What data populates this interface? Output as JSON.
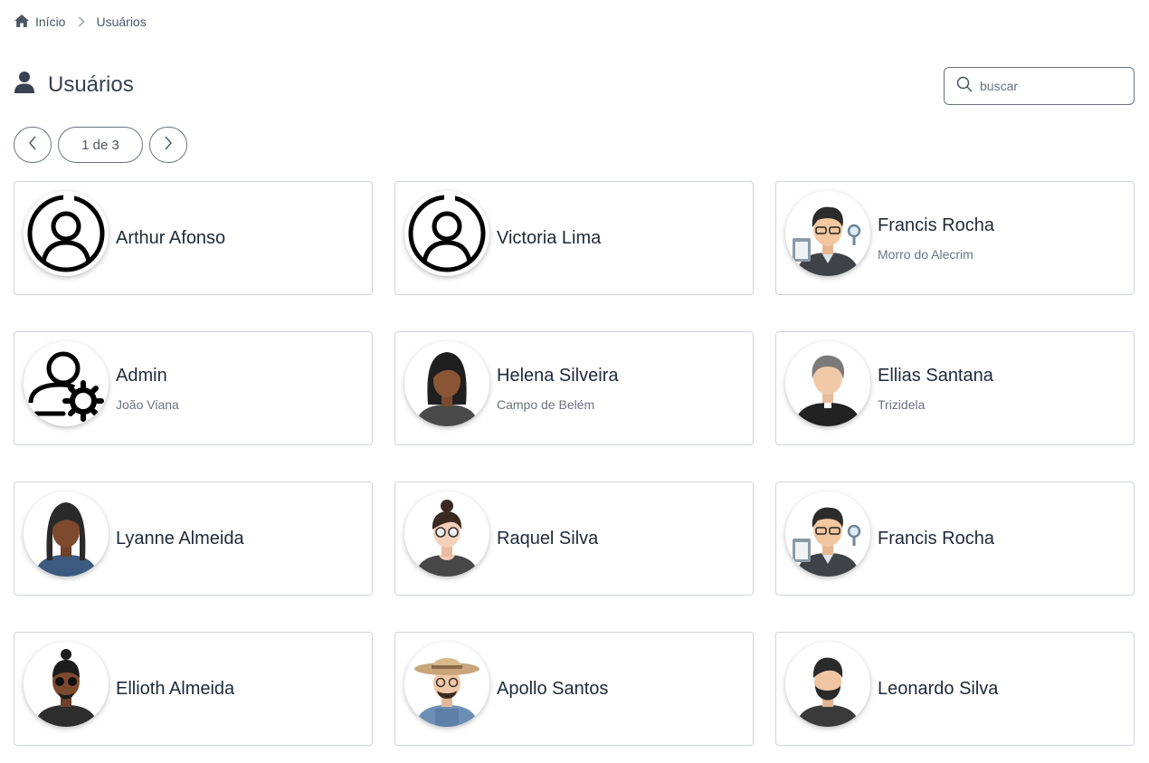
{
  "breadcrumb": {
    "home": "Início",
    "current": "Usuários"
  },
  "header": {
    "title": "Usuários"
  },
  "search": {
    "placeholder": "buscar",
    "value": ""
  },
  "pager": {
    "label": "1 de 3"
  },
  "users": [
    {
      "name": "Arthur Afonso",
      "location": "",
      "avatar": "default-user-icon"
    },
    {
      "name": "Victoria Lima",
      "location": "",
      "avatar": "default-user-icon"
    },
    {
      "name": "Francis Rocha",
      "location": "Morro do Alecrim",
      "avatar": "inspector-avatar"
    },
    {
      "name": "Admin",
      "location": "João Viana",
      "avatar": "admin-user-gear-icon"
    },
    {
      "name": "Helena Silveira",
      "location": "Campo de Belém",
      "avatar": "woman-avatar"
    },
    {
      "name": "Ellias Santana",
      "location": "Trizidela",
      "avatar": "priest-avatar"
    },
    {
      "name": "Lyanne Almeida",
      "location": "",
      "avatar": "woman-braids-avatar"
    },
    {
      "name": "Raquel Silva",
      "location": "",
      "avatar": "woman-glasses-avatar"
    },
    {
      "name": "Francis Rocha",
      "location": "",
      "avatar": "inspector-avatar"
    },
    {
      "name": "Ellioth Almeida",
      "location": "",
      "avatar": "man-sunglasses-avatar"
    },
    {
      "name": "Apollo Santos",
      "location": "",
      "avatar": "farmer-avatar"
    },
    {
      "name": "Leonardo Silva",
      "location": "",
      "avatar": "bearded-man-avatar"
    }
  ],
  "colors": {
    "text": "#1f2937",
    "muted": "#6b7280",
    "border": "#cfd4da",
    "accent": "#374151"
  }
}
